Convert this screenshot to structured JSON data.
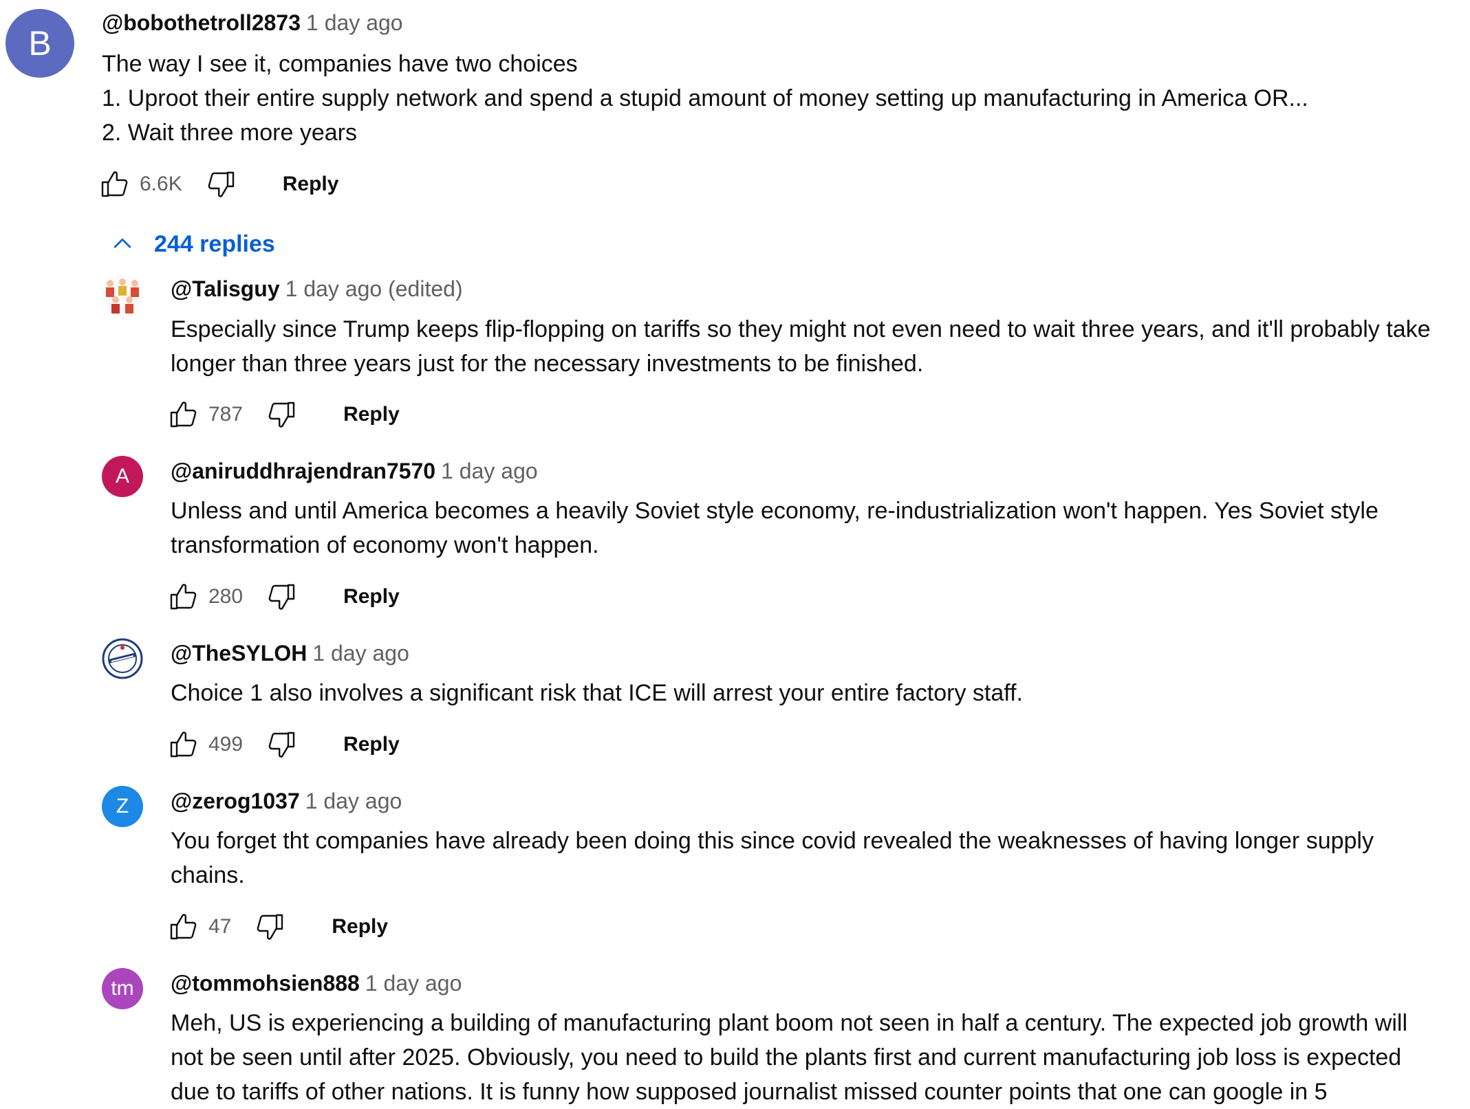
{
  "main_comment": {
    "avatar_letter": "B",
    "avatar_color": "#5c6bc0",
    "author": "@bobothetroll2873",
    "timestamp": "1 day ago",
    "lines": [
      "The way I see it, companies have two choices",
      "1. Uproot their entire supply network and spend a stupid amount of money setting up manufacturing in America OR...",
      "2. Wait three more years"
    ],
    "likes": "6.6K",
    "reply_label": "Reply"
  },
  "replies_toggle": {
    "label": "244 replies",
    "icon": "chevron-up-icon"
  },
  "replies": [
    {
      "avatar_type": "image",
      "avatar_icon": "cartoon-figures-avatar",
      "author": "@Talisguy",
      "timestamp": "1 day ago (edited)",
      "lines": [
        "Especially since Trump keeps flip-flopping on tariffs so they might not even need to wait three years, and it'll probably take",
        "longer than three years just for the necessary investments to be finished."
      ],
      "likes": "787",
      "reply_label": "Reply"
    },
    {
      "avatar_type": "letter",
      "avatar_letter": "A",
      "avatar_color": "#c2185b",
      "author": "@aniruddhrajendran7570",
      "timestamp": "1 day ago",
      "lines": [
        "Unless and until America becomes a heavily Soviet style economy, re-industrialization won't happen. Yes Soviet style",
        "transformation of economy won't happen."
      ],
      "likes": "280",
      "reply_label": "Reply"
    },
    {
      "avatar_type": "image",
      "avatar_icon": "emblem-avatar",
      "author": "@TheSYLOH",
      "timestamp": "1 day ago",
      "lines": [
        "Choice 1 also involves a significant risk that ICE will arrest your entire factory staff."
      ],
      "likes": "499",
      "reply_label": "Reply"
    },
    {
      "avatar_type": "letter",
      "avatar_letter": "Z",
      "avatar_color": "#1e88e5",
      "author": "@zerog1037",
      "timestamp": "1 day ago",
      "lines": [
        "You forget tht companies have already been doing this since covid revealed the weaknesses of having longer supply",
        "chains."
      ],
      "likes": "47",
      "reply_label": "Reply"
    },
    {
      "avatar_type": "letter",
      "avatar_letter": "tm",
      "avatar_color": "#ab47bc",
      "author": "@tommohsien888",
      "timestamp": "1 day ago",
      "lines": [
        "Meh, US is experiencing a building of manufacturing plant boom not seen in half a century. The expected job growth will",
        "not be seen until after 2025. Obviously, you need to build the plants first and current manufacturing job loss is expected",
        "due to tariffs of other nations. It is funny how supposed journalist missed counter points that one can google in 5"
      ]
    }
  ]
}
